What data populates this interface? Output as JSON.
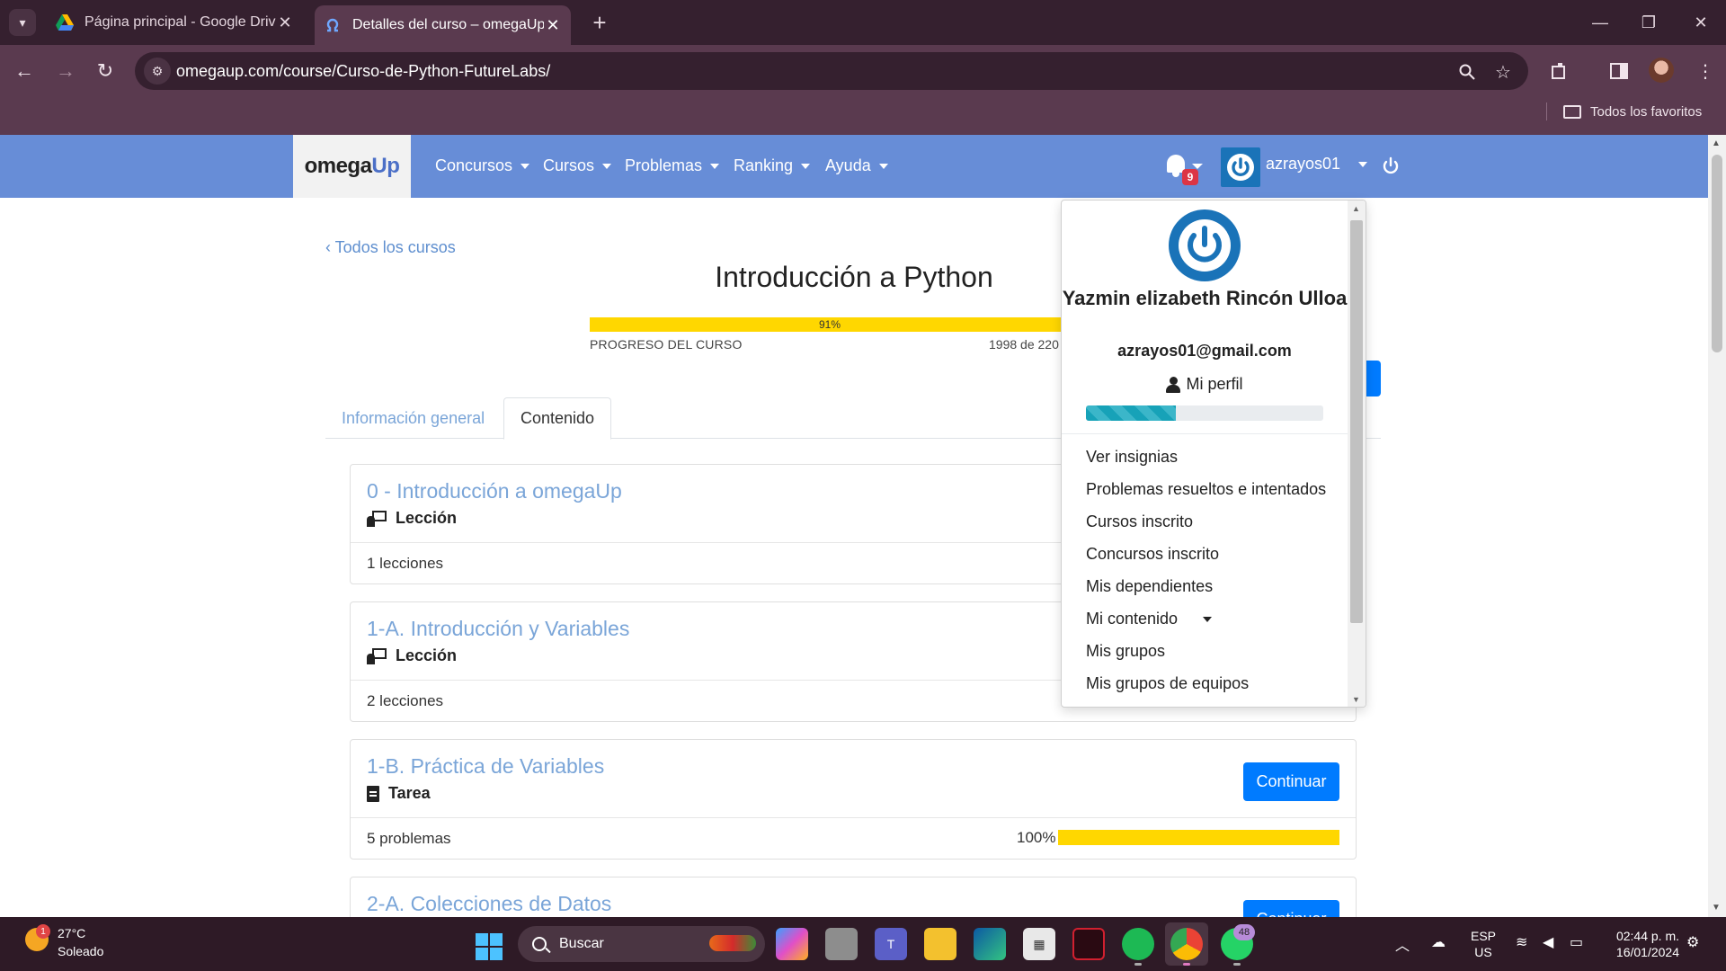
{
  "browser": {
    "tabs": [
      {
        "title": "Página principal - Google Drive",
        "active": false
      },
      {
        "title": "Detalles del curso – omegaUp",
        "active": true
      }
    ],
    "url": "omegaup.com/course/Curso-de-Python-FutureLabs/",
    "bookmarks_label": "Todos los favoritos"
  },
  "navbar": {
    "brand_omega": "omega",
    "brand_up": "Up",
    "menu": [
      "Concursos",
      "Cursos",
      "Problemas",
      "Ranking",
      "Ayuda"
    ],
    "notifications_count": "9",
    "username": "azrayos01"
  },
  "course": {
    "back_link": "Todos los cursos",
    "title": "Introducción a Python",
    "progress_percent": "91%",
    "progress_value": 0.91,
    "progress_label": "PROGRESO DEL CURSO",
    "progress_count": "1998 de 220"
  },
  "tabs": [
    "Información general",
    "Contenido"
  ],
  "cards": [
    {
      "title": "0 - Introducción a omegaUp",
      "type": "Lección",
      "footer": "1 lecciones"
    },
    {
      "title": "1-A. Introducción y Variables",
      "type": "Lección",
      "footer": "2 lecciones"
    },
    {
      "title": "1-B. Práctica de Variables",
      "type": "Tarea",
      "footer": "5 problemas",
      "button": "Continuar",
      "percent": "100%",
      "progress_value": 1.0
    },
    {
      "title": "2-A. Colecciones de Datos",
      "button": "Continuar"
    }
  ],
  "dropdown": {
    "name": "Yazmin elizabeth Rincón Ulloa",
    "email": "azrayos01@gmail.com",
    "profile_label": "Mi perfil",
    "level_progress": 0.38,
    "items": [
      "Ver insignias",
      "Problemas resueltos e intentados",
      "Cursos inscrito",
      "Concursos inscrito",
      "Mis dependientes",
      "Mi contenido",
      "Mis grupos",
      "Mis grupos de equipos"
    ]
  },
  "taskbar": {
    "weather_badge": "1",
    "temperature": "27°C",
    "weather": "Soleado",
    "search_placeholder": "Buscar",
    "whatsapp_badge": "48",
    "lang_1": "ESP",
    "lang_2": "US",
    "time": "02:44 p. m.",
    "date": "16/01/2024"
  },
  "colors": {
    "navbar": "#678dd7",
    "progress": "#ffd700",
    "primary_button": "#007bff",
    "link": "#7aa5d8"
  }
}
